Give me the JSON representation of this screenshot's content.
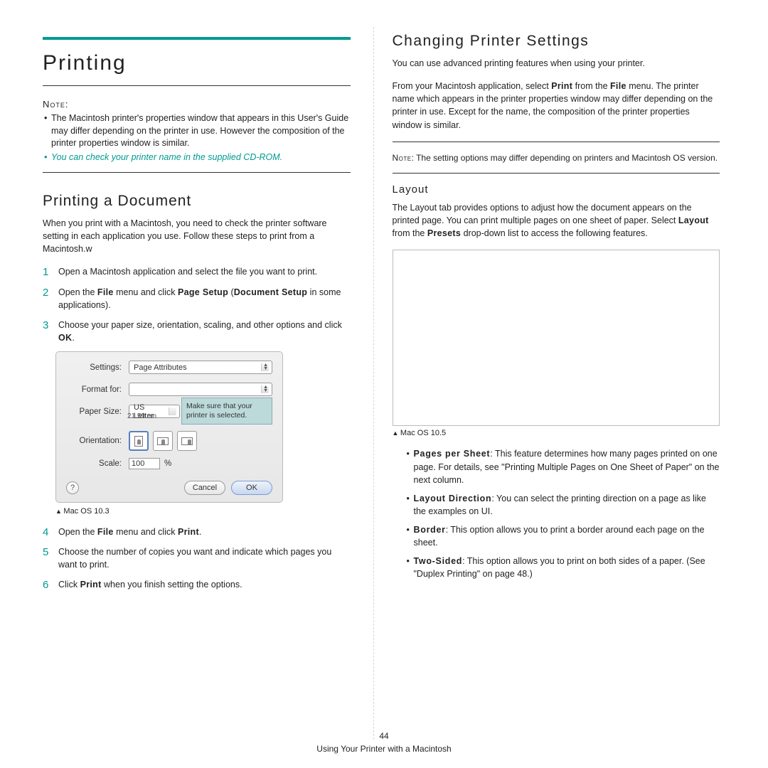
{
  "page": {
    "number": "44",
    "footer": "Using Your Printer with a Macintosh"
  },
  "left": {
    "mainTitle": "Printing",
    "noteLabel": "Note:",
    "noteItems": [
      "The Macintosh printer's properties window that appears in this User's Guide may differ depending on the printer in use. However the composition of the printer properties window is similar.",
      "You can check your printer name in the supplied CD-ROM."
    ],
    "subTitle": "Printing a Document",
    "intro": "When you print with a Macintosh, you need to check the printer software setting in each application you use. Follow these steps to print from a Macintosh.w",
    "steps": [
      "Open a Macintosh application and select the file you want to print.",
      "Open the <b>File</b> menu and click <b>Page Setup</b> (<b>Document Setup</b> in some applications).",
      "Choose your paper size, orientation, scaling, and other options and click <b>OK</b>.",
      "Open the <b>File</b> menu and click <b>Print</b>.",
      "Choose the number of copies you want and indicate which pages you want to print.",
      "Click <b>Print</b> when you finish setting the options."
    ],
    "dialog": {
      "settings_label": "Settings:",
      "settings_value": "Page Attributes",
      "format_label": "Format for:",
      "format_value": "",
      "paper_label": "Paper Size:",
      "paper_value": "US Letter",
      "paper_sub": "21.59 cm",
      "orient_label": "Orientation:",
      "scale_label": "Scale:",
      "scale_value": "100",
      "scale_pct": "%",
      "callout": "Make sure that your printer is selected.",
      "cancel": "Cancel",
      "ok": "OK",
      "help": "?"
    },
    "captionA": "Mac OS 10.3"
  },
  "right": {
    "secTitle": "Changing Printer Settings",
    "p1": "You can use advanced printing features when using your printer.",
    "p2": "From your Macintosh application, select <b>Print</b> from the <b>File</b> menu. The printer name which appears in the printer properties window may differ depending on the printer in use. Except for the name, the composition of the printer properties window is similar.",
    "noteRight": "<span class='ncaps'>Note</span>: The setting options may differ depending on printers and Macintosh OS version.",
    "layoutTitle": "Layout",
    "layoutText": "The Layout tab provides options to adjust how the document appears on the printed page. You can print multiple pages on one sheet of paper. Select <b>Layout</b> from the <b>Presets</b> drop-down list to access the following features.",
    "captionB": "Mac OS 10.5",
    "features": [
      {
        "term": "Pages per Sheet",
        "desc": ": This feature determines how many pages printed on one page. For details, see \"Printing Multiple Pages on One Sheet of Paper\" on the next column."
      },
      {
        "term": "Layout Direction",
        "desc": ": You can select the printing direction on a page as like the examples on UI."
      },
      {
        "term": "Border",
        "desc": ": This option allows you to print a border around each page on the sheet."
      },
      {
        "term": "Two-Sided",
        "desc": ": This option allows you to print on both sides of a paper. (See \"Duplex Printing\" on page 48.)"
      }
    ]
  }
}
